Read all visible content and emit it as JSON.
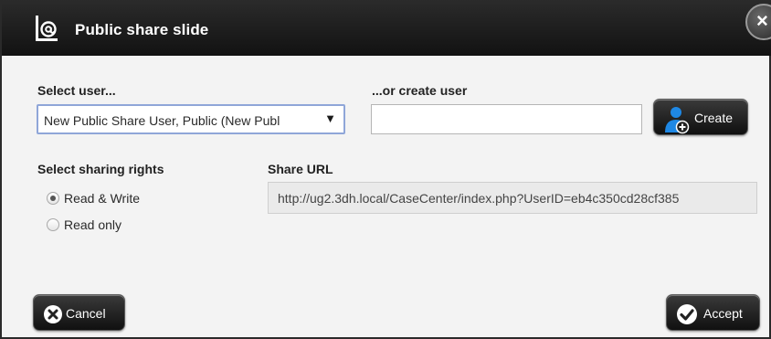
{
  "dialog": {
    "title": "Public share slide",
    "title_icon": "share-at-icon",
    "close_label": "×"
  },
  "select_user": {
    "label": "Select user...",
    "selected_value": "New Public Share User, Public (New Publ",
    "arrow_icon": "dropdown-arrow-icon"
  },
  "create_user": {
    "label": "...or create user",
    "input_value": "",
    "button_label": "Create",
    "button_icon": "add-user-icon"
  },
  "sharing_rights": {
    "label": "Select sharing rights",
    "options": [
      {
        "label": "Read & Write",
        "checked": true
      },
      {
        "label": "Read only",
        "checked": false
      }
    ]
  },
  "share_url": {
    "label": "Share URL",
    "value": "http://ug2.3dh.local/CaseCenter/index.php?UserID=eb4c350cd28cf385"
  },
  "footer": {
    "cancel_label": "Cancel",
    "cancel_icon": "close-circle-icon",
    "accept_label": "Accept",
    "accept_icon": "checkmark-circle-icon"
  },
  "colors": {
    "titlebar": "#1a1a1a",
    "dialog_background": "#f3f3f3",
    "select_border": "#8fa6d8",
    "create_icon_accent": "#1e88e5"
  }
}
